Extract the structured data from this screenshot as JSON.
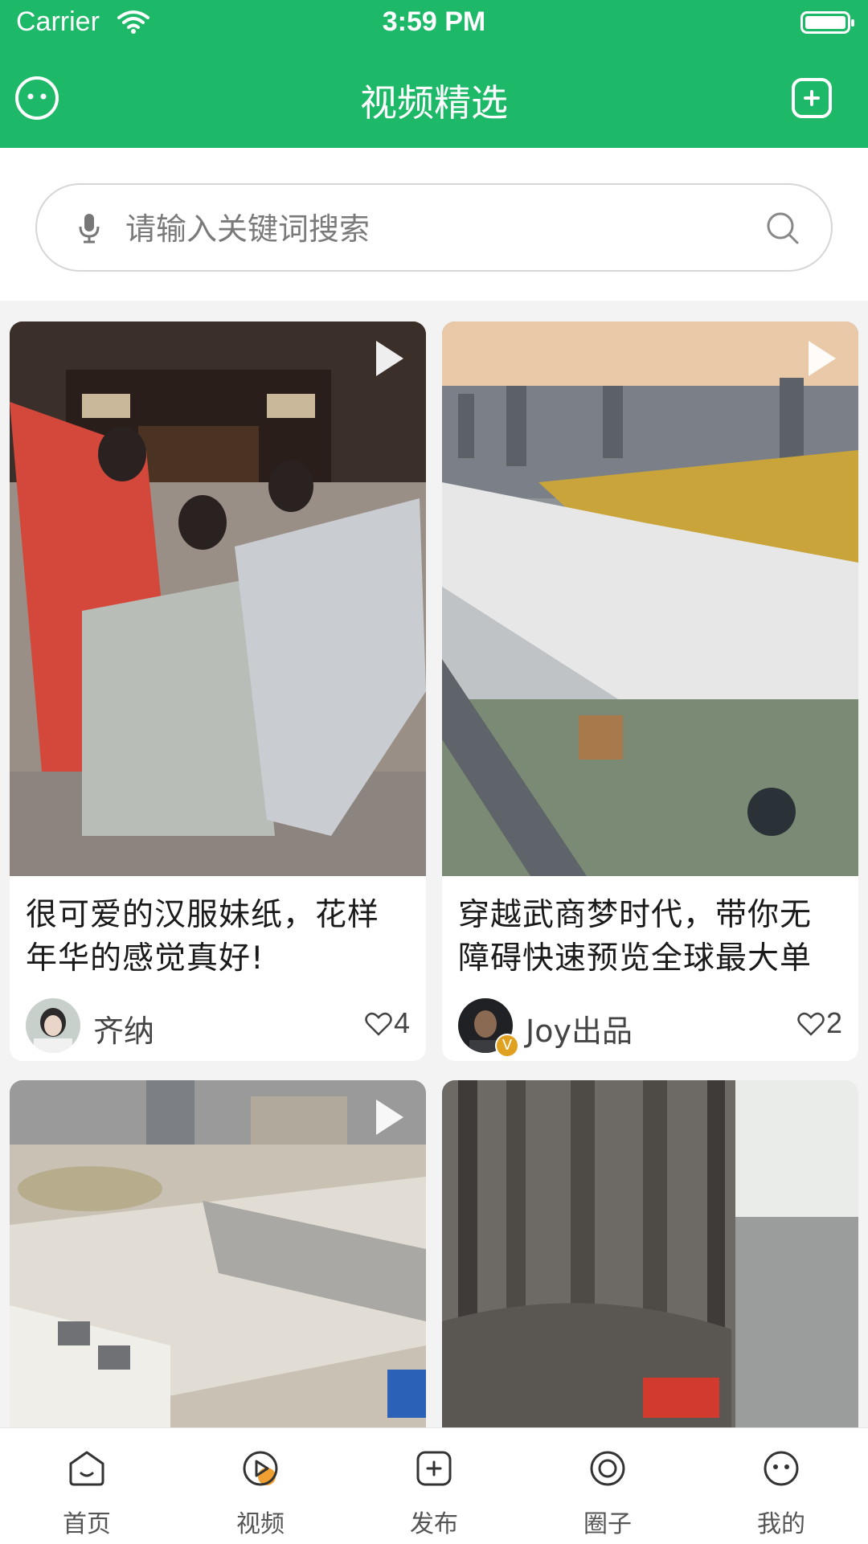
{
  "status_bar": {
    "carrier": "Carrier",
    "time": "3:59 PM"
  },
  "navbar": {
    "title": "视频精选"
  },
  "search": {
    "placeholder": "请输入关键词搜索"
  },
  "videos": [
    {
      "title": "很可爱的汉服妹纸，花样年华的感觉真好!",
      "author": "齐纳",
      "likes": "4"
    },
    {
      "title": "穿越武商梦时代，带你无障碍快速预览全球最大单",
      "author": "Joy出品",
      "likes": "2",
      "verified_badge": "V"
    },
    {
      "title": "",
      "author": "",
      "likes": ""
    },
    {
      "title": "",
      "author": "",
      "likes": ""
    }
  ],
  "tabbar": {
    "items": [
      {
        "label": "首页",
        "icon": "home-face-icon"
      },
      {
        "label": "视频",
        "icon": "video-play-icon",
        "active": true
      },
      {
        "label": "发布",
        "icon": "publish-plus-icon"
      },
      {
        "label": "圈子",
        "icon": "circle-icon"
      },
      {
        "label": "我的",
        "icon": "profile-face-icon"
      }
    ]
  },
  "colors": {
    "brand": "#1db968",
    "accent": "#f0a030"
  }
}
